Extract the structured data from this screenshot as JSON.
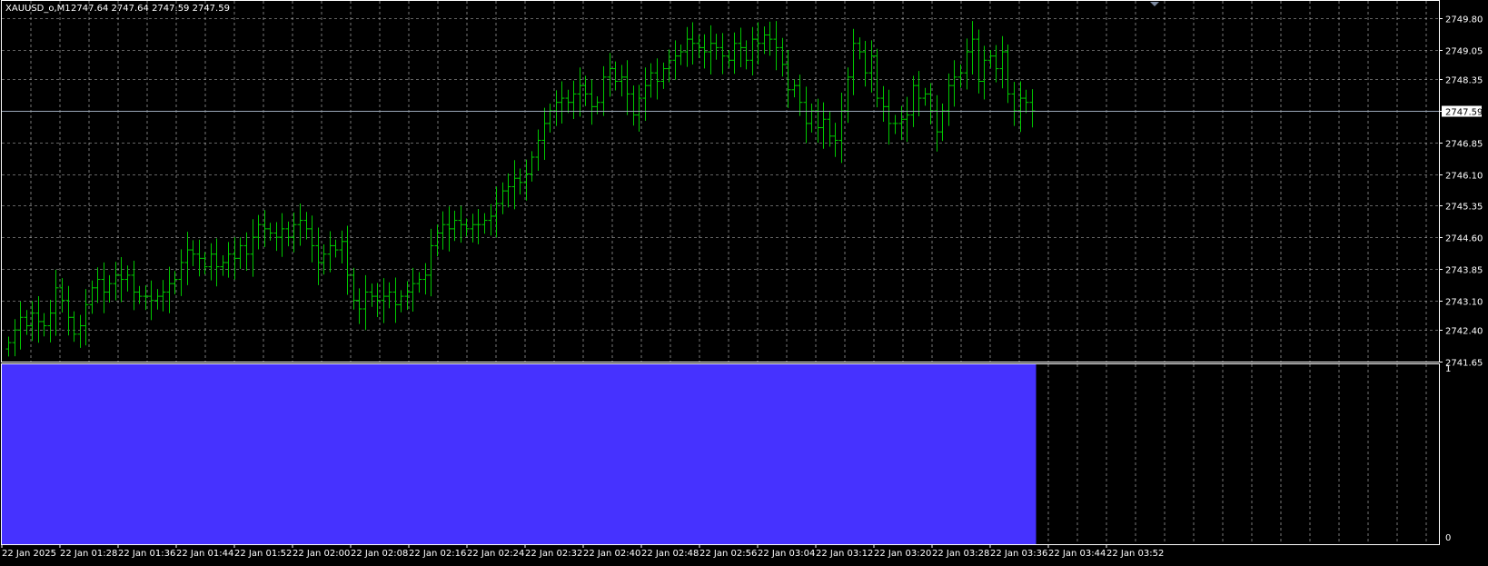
{
  "header": {
    "symbol": "XAUUSD_o,M1",
    "ohlc": "2747.64 2747.64 2747.59 2747.59"
  },
  "colors": {
    "background": "#000000",
    "grid": "#c8c8c8",
    "candle": "#00c800",
    "histogram": "#4632ff",
    "axis_text": "#ffffff",
    "bid_line": "#9aa7b8"
  },
  "chart_data": [
    {
      "type": "ohlc-bar",
      "symbol": "XAUUSD_o",
      "timeframe": "M1",
      "ylim": [
        2741.65,
        2750.1
      ],
      "y_ticks": [
        "2749.80",
        "2749.05",
        "2748.35",
        "2747.59",
        "2746.85",
        "2746.10",
        "2745.35",
        "2744.60",
        "2743.85",
        "2743.10",
        "2742.40",
        "2741.65"
      ],
      "current_price": "2747.59",
      "grid": true,
      "x_ticks": [
        "22 Jan 2025",
        "22 Jan 01:28",
        "22 Jan 01:36",
        "22 Jan 01:44",
        "22 Jan 01:52",
        "22 Jan 02:00",
        "22 Jan 02:08",
        "22 Jan 02:16",
        "22 Jan 02:24",
        "22 Jan 02:32",
        "22 Jan 02:40",
        "22 Jan 02:48",
        "22 Jan 02:56",
        "22 Jan 03:04",
        "22 Jan 03:12",
        "22 Jan 03:20",
        "22 Jan 03:28",
        "22 Jan 03:36",
        "22 Jan 03:44",
        "22 Jan 03:52"
      ],
      "close": [
        2742.1,
        2742.4,
        2742.7,
        2742.5,
        2742.8,
        2742.6,
        2742.5,
        2742.8,
        2743.4,
        2743.1,
        2742.7,
        2742.3,
        2742.5,
        2743.0,
        2743.4,
        2743.6,
        2743.3,
        2743.5,
        2743.7,
        2743.6,
        2743.7,
        2743.3,
        2743.2,
        2743.2,
        2743.1,
        2743.2,
        2743.3,
        2743.5,
        2743.6,
        2744.0,
        2744.3,
        2744.2,
        2744.1,
        2743.9,
        2744.2,
        2743.9,
        2744.0,
        2744.2,
        2744.1,
        2744.4,
        2744.2,
        2744.6,
        2744.9,
        2744.8,
        2744.7,
        2744.6,
        2744.8,
        2744.6,
        2744.9,
        2745.0,
        2744.8,
        2744.4,
        2744.0,
        2744.2,
        2744.4,
        2744.3,
        2744.5,
        2743.7,
        2743.1,
        2742.9,
        2743.3,
        2743.2,
        2743.1,
        2743.2,
        2743.3,
        2743.0,
        2743.2,
        2743.3,
        2743.5,
        2743.6,
        2743.7,
        2744.4,
        2744.7,
        2744.9,
        2744.8,
        2745.0,
        2744.9,
        2744.8,
        2744.9,
        2744.9,
        2745.0,
        2745.1,
        2745.4,
        2745.7,
        2745.8,
        2746.0,
        2745.9,
        2746.1,
        2746.5,
        2746.9,
        2747.3,
        2747.6,
        2747.8,
        2747.9,
        2747.8,
        2748.0,
        2748.2,
        2748.0,
        2747.7,
        2747.8,
        2748.4,
        2748.6,
        2748.3,
        2748.4,
        2748.0,
        2747.5,
        2747.9,
        2748.2,
        2748.5,
        2748.3,
        2748.6,
        2748.8,
        2748.9,
        2749.0,
        2749.3,
        2749.2,
        2749.1,
        2749.0,
        2749.2,
        2749.1,
        2748.9,
        2748.8,
        2749.2,
        2749.1,
        2748.8,
        2749.3,
        2749.2,
        2749.4,
        2749.3,
        2749.1,
        2748.7,
        2748.1,
        2748.2,
        2747.8,
        2747.3,
        2747.6,
        2747.2,
        2747.4,
        2747.0,
        2746.9,
        2747.6,
        2748.4,
        2749.2,
        2749.0,
        2748.5,
        2748.9,
        2747.9,
        2747.7,
        2747.3,
        2747.3,
        2747.4,
        2747.5,
        2748.2,
        2747.9,
        2748.0,
        2747.6,
        2747.1,
        2747.6,
        2748.2,
        2748.4,
        2748.5,
        2749.0,
        2749.3,
        2748.3,
        2748.8,
        2748.9,
        2748.6,
        2749.0,
        2748.0,
        2747.6,
        2747.9,
        2747.8,
        2747.6
      ]
    },
    {
      "type": "histogram",
      "ylim": [
        0,
        1
      ],
      "y_ticks": [
        "1",
        "0"
      ],
      "value": 1,
      "filled_through": "22 Jan 03:52"
    }
  ]
}
